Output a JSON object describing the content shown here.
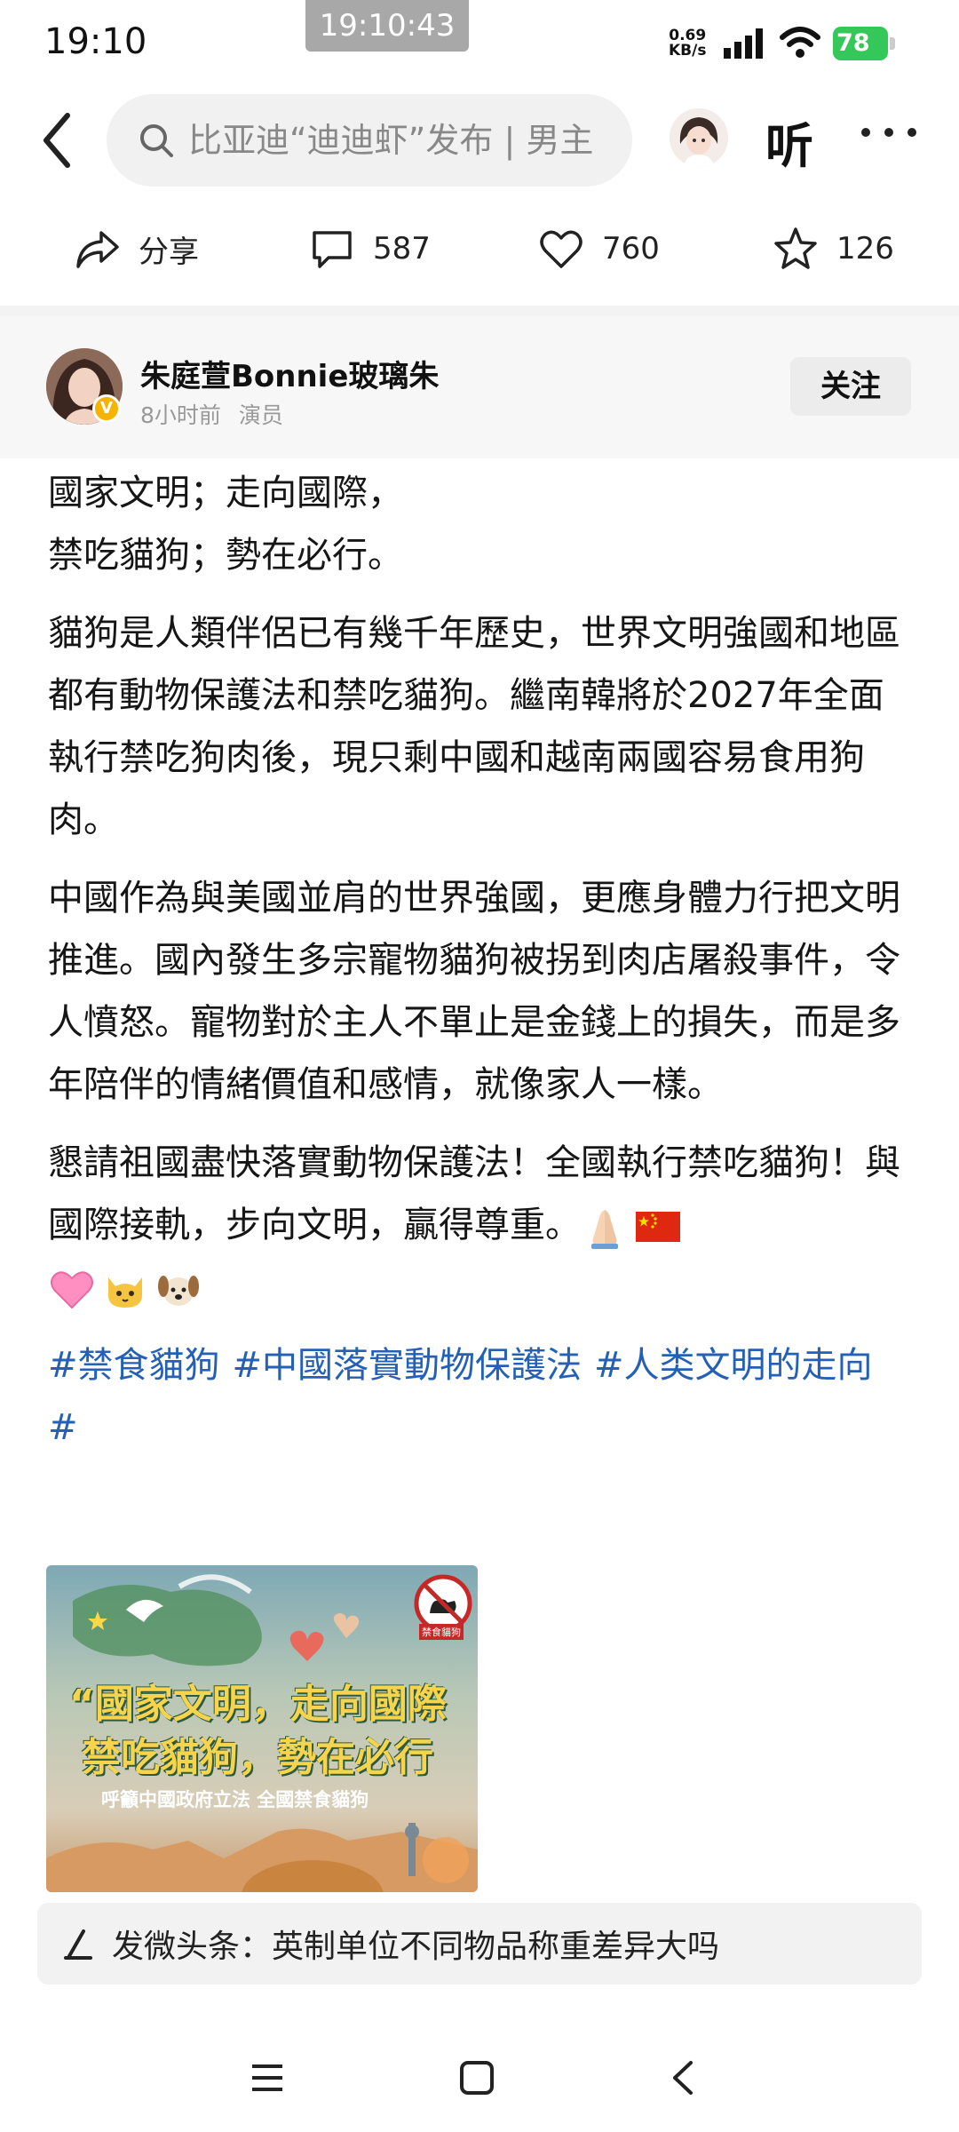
{
  "status_bar": {
    "time": "19:10",
    "timestamp_badge": "19:10:43",
    "net_speed_value": "0.69",
    "net_speed_unit": "KB/s",
    "battery": "78"
  },
  "header": {
    "search_placeholder": "比亚迪“迪迪虾”发布 | 男主",
    "listen_label": "听"
  },
  "actions": {
    "share_label": "分享",
    "comments": "587",
    "likes": "760",
    "favorites": "126"
  },
  "author": {
    "name": "朱庭萱Bonnie玻璃朱",
    "time_ago": "8小时前",
    "role": "演员",
    "follow_label": "关注"
  },
  "post": {
    "para1_line1": "國家文明；走向國際，",
    "para1_line2": "禁吃貓狗；勢在必行。",
    "para2": "貓狗是人類伴侶已有幾千年歷史，世界文明強國和地區都有動物保護法和禁吃貓狗。繼南韓將於2027年全面執行禁吃狗肉後，現只剩中國和越南兩國容易食用狗肉。",
    "para3": "中國作為與美國並肩的世界強國，更應身體力行把文明推進。國內發生多宗寵物貓狗被拐到肉店屠殺事件，令人憤怒。寵物對於主人不單止是金錢上的損失，而是多年陪伴的情緒價值和感情，就像家人一樣。",
    "para4": "懇請祖國盡快落實動物保護法！全國執行禁吃貓狗！與國際接軌，步向文明，贏得尊重。",
    "emojis": [
      "praying-hands",
      "china-flag",
      "pink-heart",
      "cat-face",
      "dog-face"
    ],
    "hashtags": [
      "#禁食貓狗",
      "#中國落實動物保護法",
      "#人类文明的走向#"
    ]
  },
  "poster": {
    "line1": "“國家文明，走向國際",
    "line2": "禁吃貓狗，勢在必行",
    "sub": "呼籲中國政府立法 全國禁食貓狗",
    "sign_label": "禁食貓狗"
  },
  "compose": {
    "text": "发微头条：英制单位不同物品称重差异大吗"
  },
  "colors": {
    "hashtag": "#2460b5",
    "battery": "#34c759",
    "verified": "#f5b400"
  }
}
